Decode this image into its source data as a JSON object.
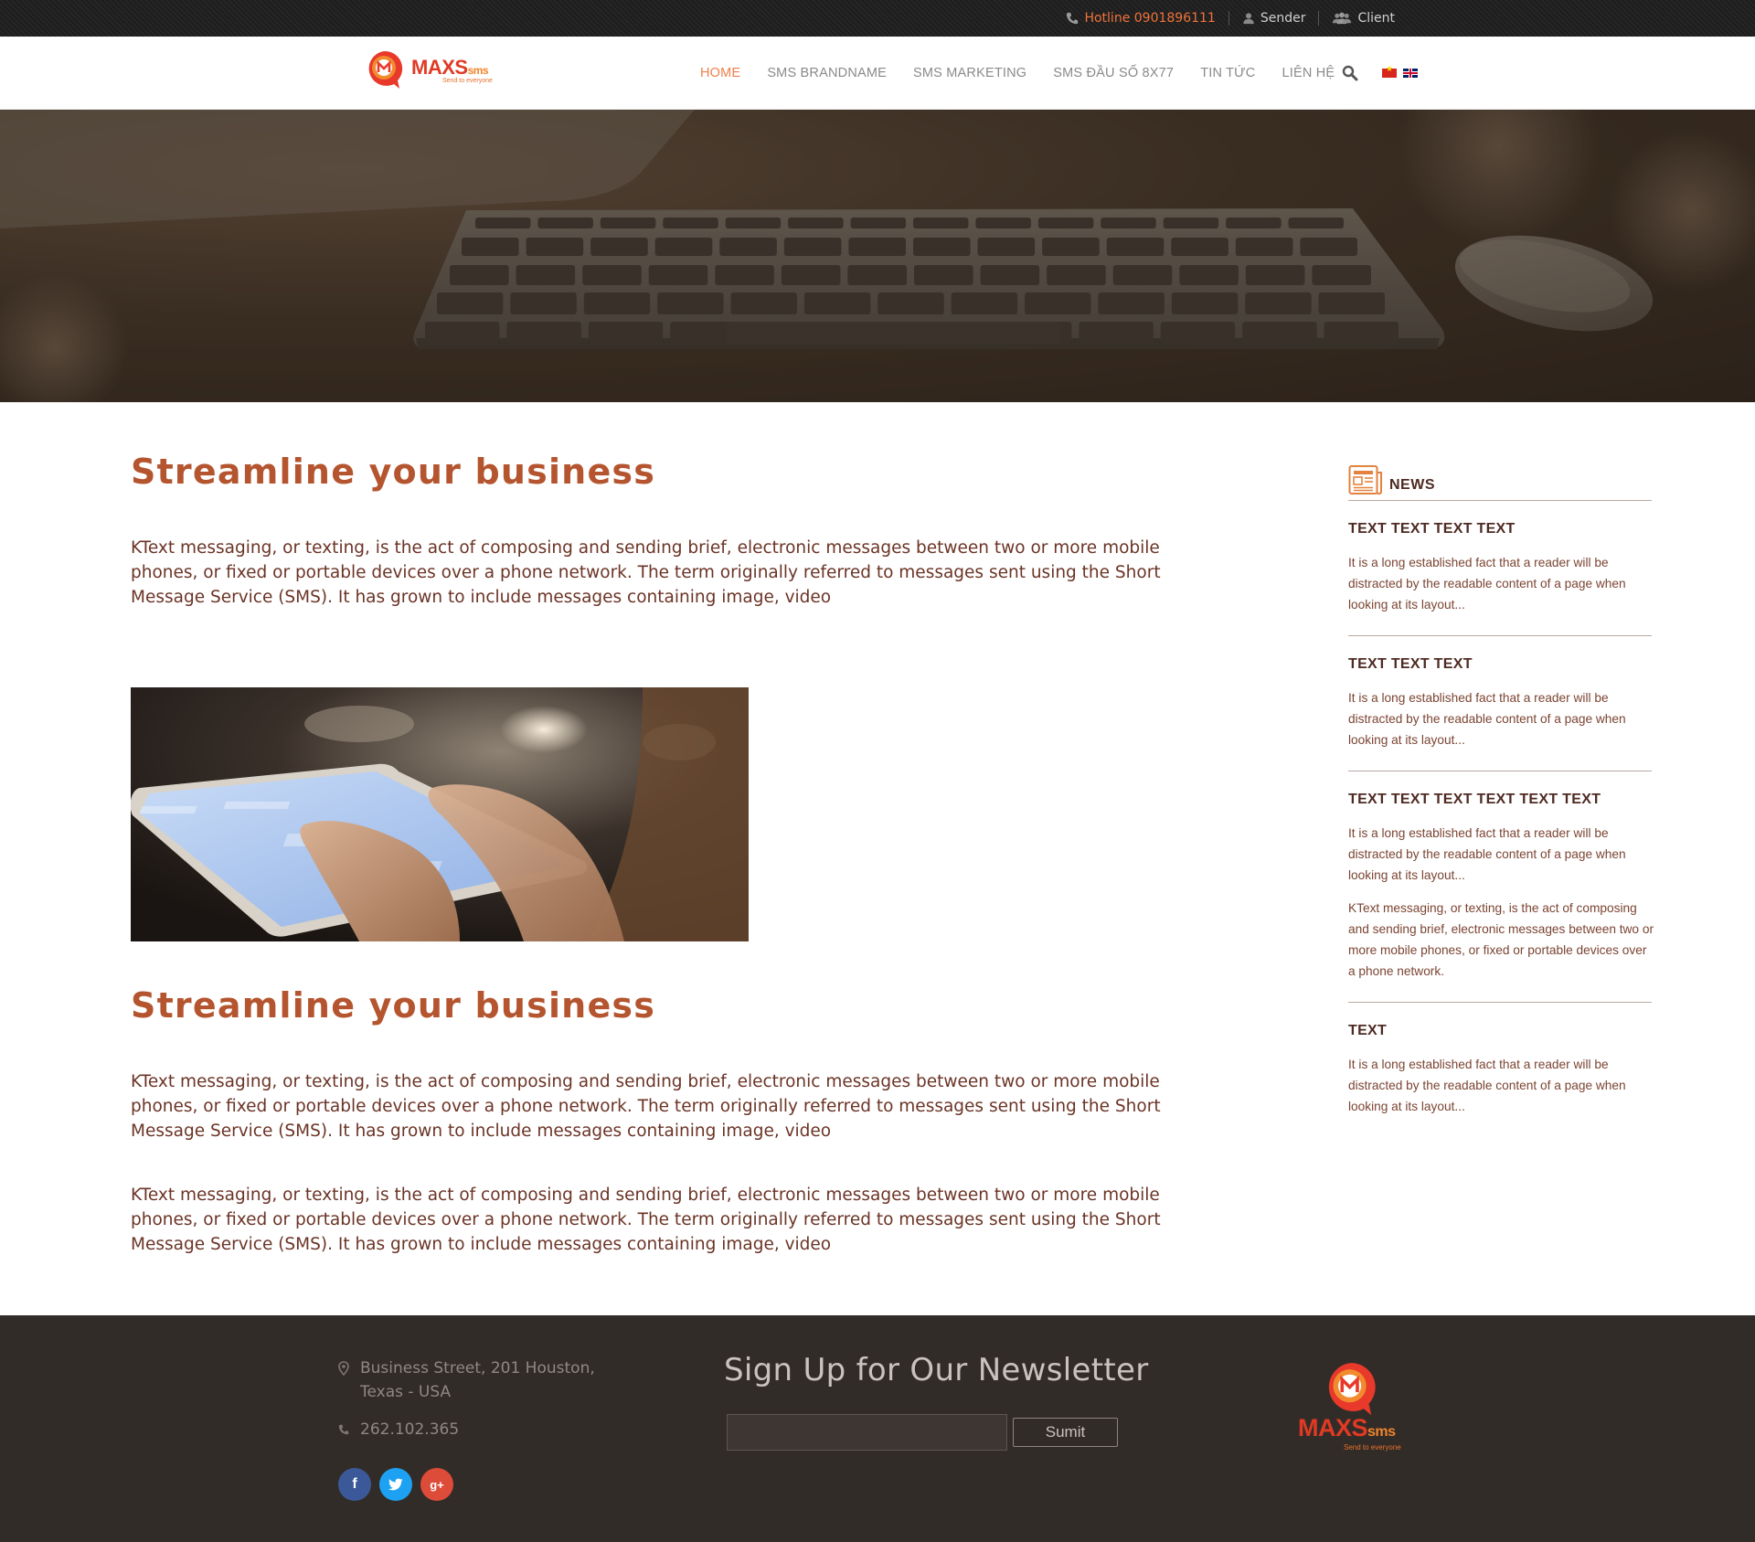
{
  "topbar": {
    "hotline": "Hotline 0901896111",
    "sender": "Sender",
    "client": "Client"
  },
  "header": {
    "logo_main": "MAXS",
    "logo_sms": "sms",
    "logo_tagline": "Send to everyone",
    "nav": [
      "HOME",
      "SMS BRANDNAME",
      "SMS MARKETING",
      "SMS ĐẦU SỐ 8X77",
      "TIN TỨC",
      "LIÊN HỆ"
    ],
    "active_nav": "HOME",
    "accent_color": "#f07e4a"
  },
  "main": {
    "sections": [
      {
        "title": "Streamline your business",
        "paragraphs": [
          "KText messaging, or texting, is the act of composing and sending brief, electronic messages between two or more mobile phones, or fixed or portable devices over a phone network. The term originally referred to messages sent using the Short Message Service (SMS). It has grown to include messages containing image, video"
        ]
      },
      {
        "title": "Streamline your business",
        "paragraphs": [
          "KText messaging, or texting, is the act of composing and sending brief, electronic messages between two or more mobile phones, or fixed or portable devices over a phone network. The term originally referred to messages sent using the Short Message Service (SMS). It has grown to include messages containing image, video",
          "KText messaging, or texting, is the act of composing and sending brief, electronic messages between two or more mobile phones, or fixed or portable devices over a phone network. The term originally referred to messages sent using the Short Message Service (SMS). It has grown to include messages containing image, video"
        ]
      }
    ],
    "title_color": "#b4552f"
  },
  "sidebar": {
    "heading": "NEWS",
    "items": [
      {
        "title": "TEXT TEXT TEXT TEXT",
        "text": "It is a long established fact that a reader will be distracted by the readable content of a page when looking at its layout..."
      },
      {
        "title": "TEXT TEXT TEXT",
        "text": "It is a long established fact that a reader will be distracted by the readable content of a page when looking at its layout..."
      },
      {
        "title": "TEXT TEXT TEXT TEXT TEXT TEXT",
        "text": "It is a long established fact that a reader will be distracted by the readable content of a page when looking at its layout...",
        "extra": "KText messaging, or texting, is the act of composing and sending brief, electronic messages between two or more mobile phones, or fixed or portable devices over a phone network."
      },
      {
        "title": "TEXT",
        "text": "It is a long established fact that a reader will be distracted by the readable content of a page when looking at its layout..."
      }
    ]
  },
  "footer": {
    "address": "Business Street, 201 Houston, Texas - USA",
    "phone": "262.102.365",
    "newsletter_title": "Sign Up for Our Newsletter",
    "submit_label": "Sumit",
    "email_value": "",
    "social": [
      "facebook",
      "twitter",
      "google-plus"
    ],
    "background": "#322c28"
  }
}
